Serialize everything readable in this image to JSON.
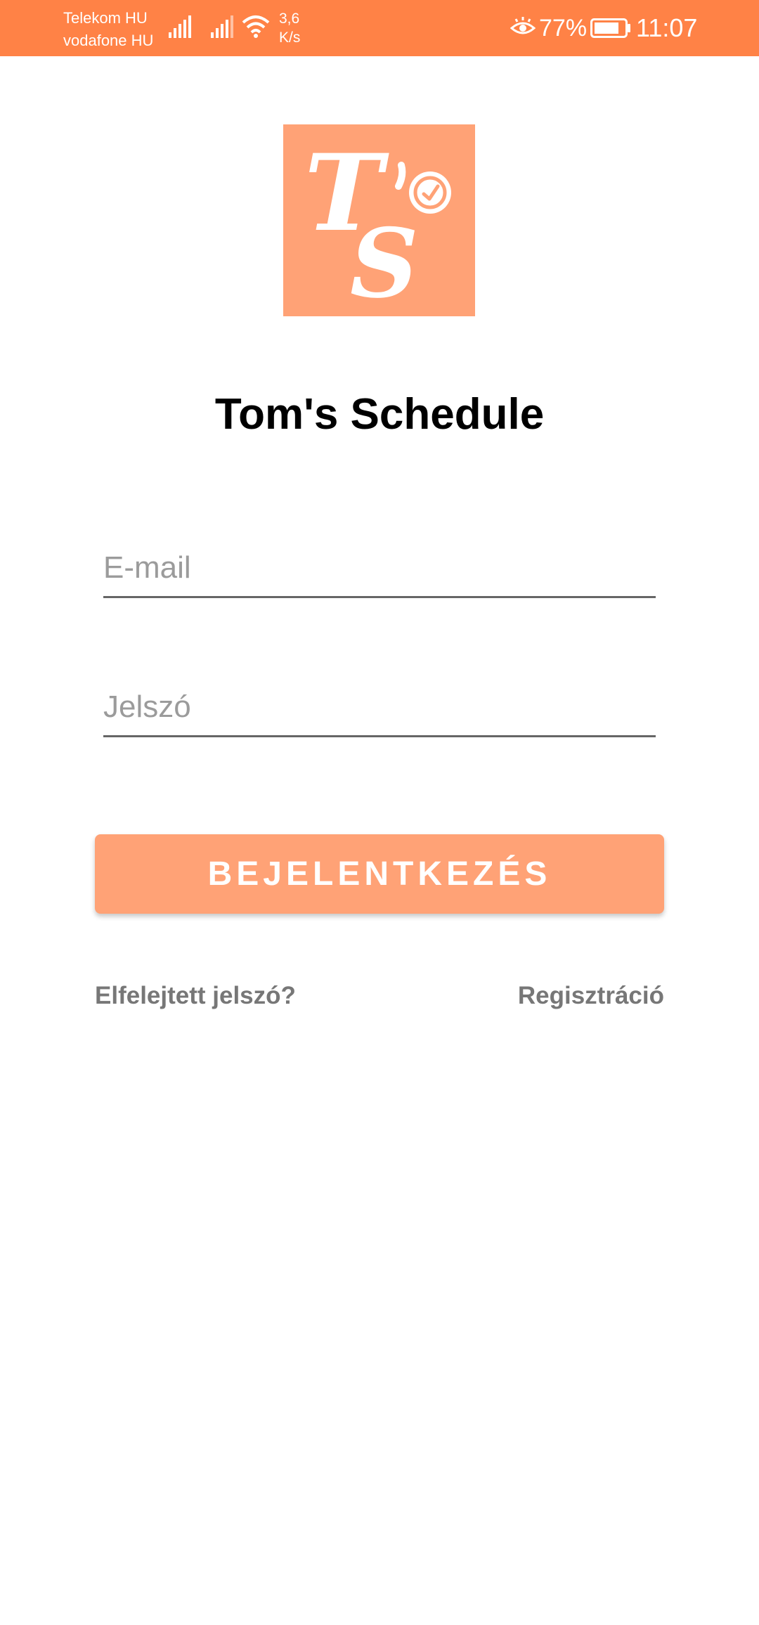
{
  "status_bar": {
    "carrier_1": "Telekom HU",
    "carrier_2": "vodafone HU",
    "speed_value": "3,6",
    "speed_unit": "K/s",
    "battery_percent": "77%",
    "time": "11:07",
    "icons": [
      "signal-icon",
      "signal-icon",
      "wifi-icon",
      "eye-comfort-icon",
      "battery-icon"
    ],
    "background_color": "#ff8246"
  },
  "logo": {
    "text_top": "T",
    "text_bottom": "S",
    "background_color": "#ffa276"
  },
  "app_title": "Tom's Schedule",
  "login_form": {
    "email_placeholder": "E-mail",
    "email_value": "",
    "password_placeholder": "Jelszó",
    "password_value": "",
    "submit_label": "BEJELENTKEZÉS",
    "accent_color": "#ffa276"
  },
  "links": {
    "forgot_password": "Elfelejtett jelszó?",
    "register": "Regisztráció"
  }
}
